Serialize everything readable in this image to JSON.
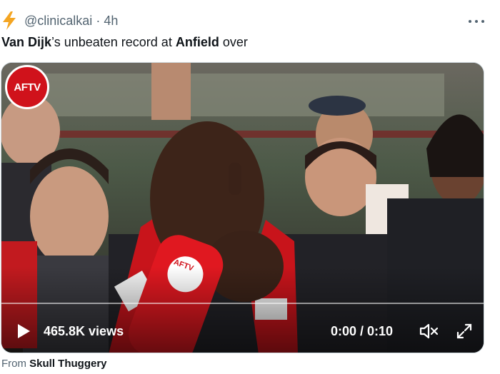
{
  "tweet": {
    "handle": "@clinicalkai",
    "separator": "·",
    "time": "4h",
    "text_parts": {
      "p1": "Van Dijk",
      "p2": "’s unbeaten record at ",
      "p3": "Anfield",
      "p4": " over"
    }
  },
  "video": {
    "channel_badge": "AFTV",
    "mic_label": "AFTV",
    "views": "465.8K views",
    "time_display": "0:00 / 0:10",
    "progress": 0
  },
  "footer": {
    "prefix": "From",
    "source_name": "Skull Thuggery"
  },
  "colors": {
    "accent_red": "#d0121b",
    "text_secondary": "#536471",
    "text_primary": "#0f1419",
    "bolt": "#f4a522"
  },
  "icons": [
    "lightning-bolt-icon",
    "more-options-icon",
    "play-icon",
    "volume-icon",
    "fullscreen-icon"
  ]
}
